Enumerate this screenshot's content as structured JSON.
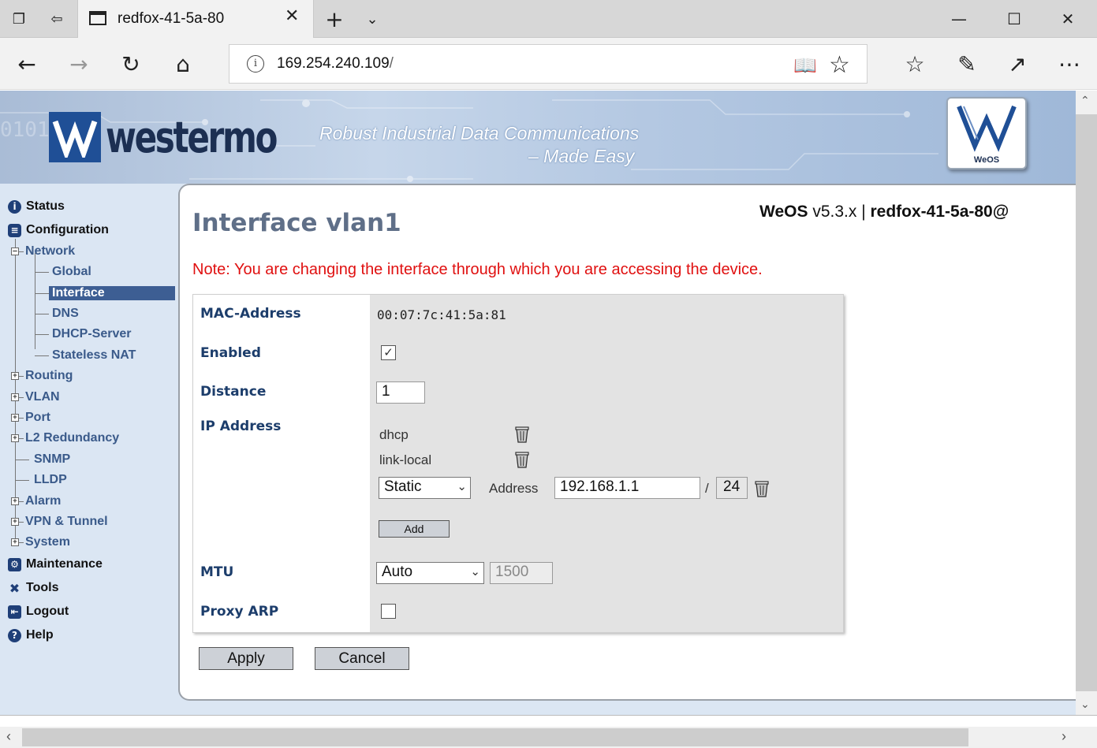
{
  "browser": {
    "tab_title": "redfox-41-5a-80",
    "url_host": "169.254.240.109",
    "url_path": "/"
  },
  "banner": {
    "brand": "westermo",
    "tagline_1": "Robust Industrial Data Communications",
    "tagline_2": "– Made Easy",
    "badge_text": "WeOS"
  },
  "sidebar": {
    "status": "Status",
    "configuration": "Configuration",
    "network": "Network",
    "network_items": [
      "Global",
      "Interface",
      "DNS",
      "DHCP-Server",
      "Stateless NAT"
    ],
    "config_items": [
      "Routing",
      "VLAN",
      "Port",
      "L2 Redundancy",
      "SNMP",
      "LLDP",
      "Alarm",
      "VPN & Tunnel",
      "System"
    ],
    "maintenance": "Maintenance",
    "tools": "Tools",
    "logout": "Logout",
    "help": "Help",
    "active_item": "Interface"
  },
  "header": {
    "title": "Interface vlan1",
    "product": "WeOS",
    "version": "v5.3.x",
    "separator": "|",
    "hostname": "redfox-41-5a-80@"
  },
  "note": "Note: You are changing the interface through which you are accessing the device.",
  "form": {
    "mac_label": "MAC-Address",
    "mac_value": "00:07:7c:41:5a:81",
    "enabled_label": "Enabled",
    "enabled_checked": true,
    "distance_label": "Distance",
    "distance_value": "1",
    "ip_label": "IP Address",
    "ip_entries": [
      "dhcp",
      "link-local"
    ],
    "ip_mode": "Static",
    "address_label": "Address",
    "address_value": "192.168.1.1",
    "slash": "/",
    "prefix_value": "24",
    "add_label": "Add",
    "mtu_label": "MTU",
    "mtu_mode": "Auto",
    "mtu_value": "1500",
    "proxy_arp_label": "Proxy ARP",
    "proxy_arp_checked": false
  },
  "buttons": {
    "apply": "Apply",
    "cancel": "Cancel"
  }
}
